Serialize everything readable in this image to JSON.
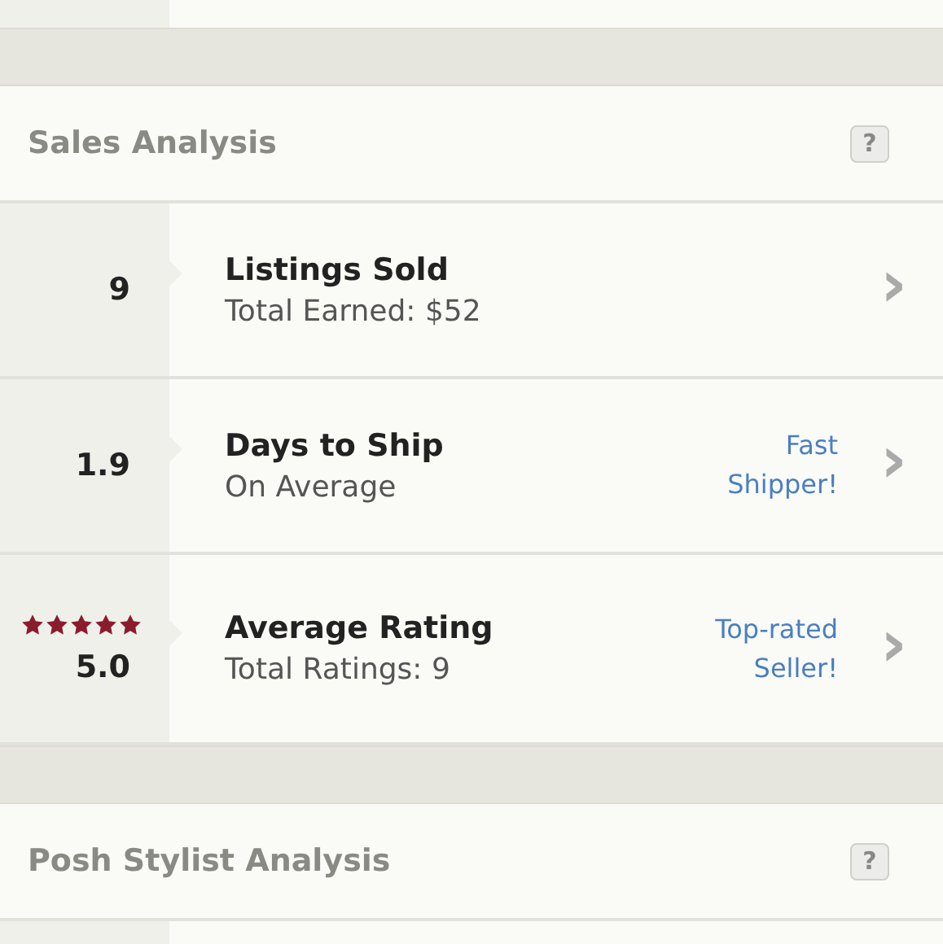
{
  "sections": [
    {
      "title": "Sales Analysis",
      "help": "?",
      "rows": [
        {
          "value": "9",
          "title": "Listings Sold",
          "subtitle": "Total Earned: $52",
          "chevron": "›"
        },
        {
          "value": "1.9",
          "title": "Days to Ship",
          "subtitle": "On Average",
          "badge": "Fast Shipper!",
          "chevron": "›"
        },
        {
          "value": "5.0",
          "stars": 5,
          "title": "Average Rating",
          "subtitle": "Total Ratings: 9",
          "badge": "Top-rated Seller!",
          "chevron": "›"
        }
      ]
    },
    {
      "title": "Posh Stylist Analysis",
      "help": "?"
    }
  ]
}
